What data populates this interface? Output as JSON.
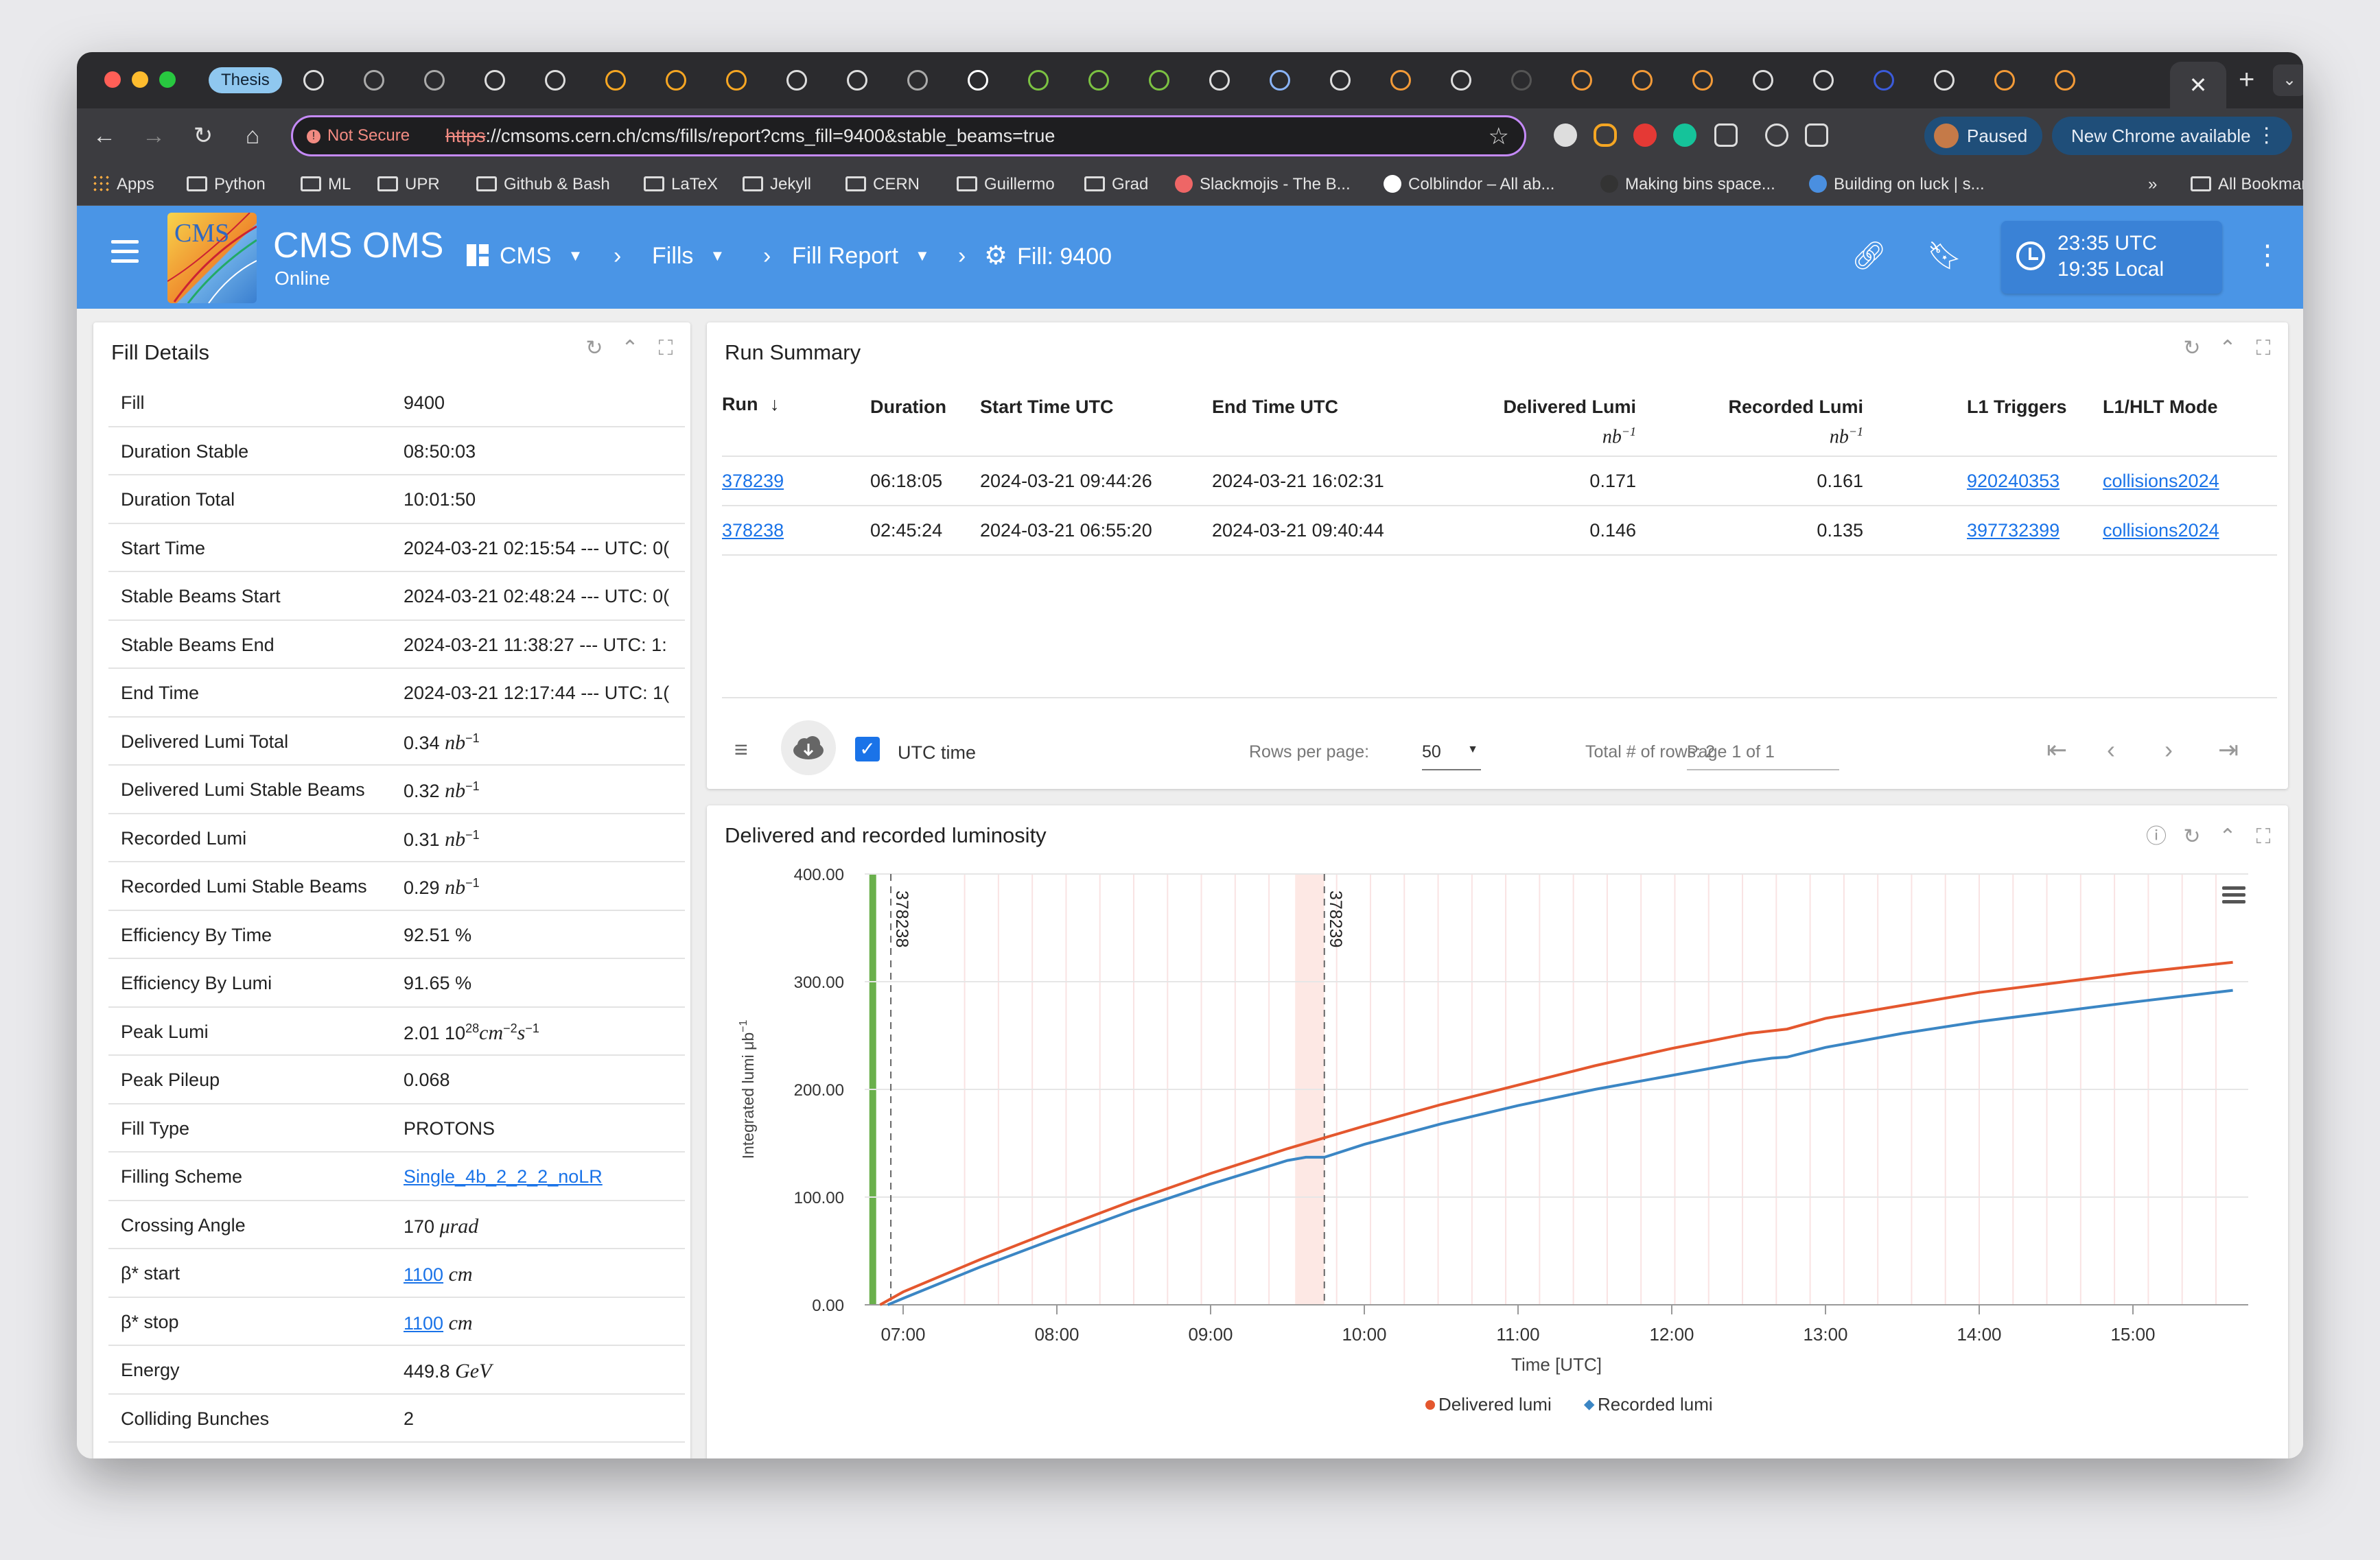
{
  "browser": {
    "tabs": {
      "pinned_label": "Thesis",
      "close_symbol": "✕",
      "new_tab_symbol": "+"
    },
    "url_bar": {
      "security_label": "Not Secure",
      "url_scheme": "https",
      "url_rest": "://cmsoms.cern.ch/cms/fills/report?cms_fill=9400&stable_beams=true"
    },
    "profile_label": "Paused",
    "update_label": "New Chrome available",
    "bookmarks": [
      "Apps",
      "Python",
      "ML",
      "UPR",
      "Github & Bash",
      "LaTeX",
      "Jekyll",
      "CERN",
      "Guillermo",
      "Grad",
      "Slackmojis - The B...",
      "Colblindor – All ab...",
      "Making bins space...",
      "Building on luck | s...",
      "»",
      "All Bookmarks"
    ]
  },
  "app": {
    "logo_text": "CMS",
    "title": "CMS OMS",
    "subtitle": "Online",
    "breadcrumbs": [
      "CMS",
      "Fills",
      "Fill Report",
      "Fill: 9400"
    ],
    "clock": {
      "utc": "23:35 UTC",
      "local": "19:35 Local"
    }
  },
  "fill_details": {
    "title": "Fill Details",
    "rows": [
      {
        "label": "Fill",
        "value": "9400"
      },
      {
        "label": "Duration Stable",
        "value": "08:50:03"
      },
      {
        "label": "Duration Total",
        "value": "10:01:50"
      },
      {
        "label": "Start Time",
        "value": "2024-03-21 02:15:54 --- UTC: 0("
      },
      {
        "label": "Stable Beams Start",
        "value": "2024-03-21 02:48:24 --- UTC: 0("
      },
      {
        "label": "Stable Beams End",
        "value": "2024-03-21 11:38:27 --- UTC: 1:"
      },
      {
        "label": "End Time",
        "value": "2024-03-21 12:17:44 --- UTC: 1("
      },
      {
        "label": "Delivered Lumi Total",
        "value": "0.34",
        "unit": "nb",
        "exp": "−1"
      },
      {
        "label": "Delivered Lumi Stable Beams",
        "value": "0.32",
        "unit": "nb",
        "exp": "−1"
      },
      {
        "label": "Recorded Lumi",
        "value": "0.31",
        "unit": "nb",
        "exp": "−1"
      },
      {
        "label": "Recorded Lumi Stable Beams",
        "value": "0.29",
        "unit": "nb",
        "exp": "−1"
      },
      {
        "label": "Efficiency By Time",
        "value": "92.51",
        "unit": "%"
      },
      {
        "label": "Efficiency By Lumi",
        "value": "91.65",
        "unit": "%"
      },
      {
        "label": "Peak Lumi",
        "value": "2.01 10",
        "exp": "28",
        "unit": "cm",
        "exp2": "−2",
        "unit2": "s",
        "exp3": "−1"
      },
      {
        "label": "Peak Pileup",
        "value": "0.068"
      },
      {
        "label": "Fill Type",
        "value": "PROTONS"
      },
      {
        "label": "Filling Scheme",
        "value": "Single_4b_2_2_2_noLR",
        "link": true
      },
      {
        "label": "Crossing Angle",
        "value": "170",
        "unit": "μrad"
      },
      {
        "label": "β* start",
        "value": "1100",
        "unit": "cm",
        "link": true
      },
      {
        "label": "β* stop",
        "value": "1100",
        "unit": "cm",
        "link": true
      },
      {
        "label": "Energy",
        "value": "449.8",
        "unit": "GeV"
      },
      {
        "label": "Colliding Bunches",
        "value": "2"
      }
    ]
  },
  "run_summary": {
    "title": "Run Summary",
    "columns": [
      "Run",
      "Duration",
      "Start Time UTC",
      "End Time UTC",
      "Delivered Lumi",
      "Recorded Lumi",
      "L1 Triggers",
      "L1/HLT Mode"
    ],
    "lumi_unit": "nb",
    "lumi_exp": "−1",
    "rows": [
      {
        "run": "378239",
        "duration": "06:18:05",
        "start": "2024-03-21 09:44:26",
        "end": "2024-03-21 16:02:31",
        "delivered": "0.171",
        "recorded": "0.161",
        "l1": "920240353",
        "mode": "collisions2024"
      },
      {
        "run": "378238",
        "duration": "02:45:24",
        "start": "2024-03-21 06:55:20",
        "end": "2024-03-21 09:40:44",
        "delivered": "0.146",
        "recorded": "0.135",
        "l1": "397732399",
        "mode": "collisions2024"
      }
    ],
    "footer": {
      "utc_label": "UTC time",
      "rows_per_page_label": "Rows per page:",
      "rows_per_page_value": "50",
      "total_rows": "Total # of rows: 2",
      "page": "Page 1 of 1"
    }
  },
  "lumi_chart": {
    "title": "Delivered and recorded luminosity"
  },
  "chart_data": {
    "type": "line",
    "title": "Delivered and recorded luminosity",
    "xlabel": "Time [UTC]",
    "ylabel": "Integrated lumi μb",
    "ylabel_exp": "−1",
    "x_ticks": [
      "07:00",
      "08:00",
      "09:00",
      "10:00",
      "11:00",
      "12:00",
      "13:00",
      "14:00",
      "15:00"
    ],
    "y_ticks": [
      "0.00",
      "100.00",
      "200.00",
      "300.00",
      "400.00"
    ],
    "xlim_hours": [
      6.75,
      15.75
    ],
    "ylim": [
      0,
      400
    ],
    "run_markers": [
      {
        "label": "378238",
        "time_hours": 6.92
      },
      {
        "label": "378239",
        "time_hours": 9.74
      }
    ],
    "legend_position": "bottom-center",
    "series": [
      {
        "name": "Delivered lumi",
        "color": "#e4572e",
        "x": [
          6.85,
          7.0,
          7.5,
          8.0,
          8.5,
          9.0,
          9.5,
          9.74,
          10.0,
          10.5,
          11.0,
          11.5,
          12.0,
          12.5,
          12.75,
          13.0,
          13.5,
          14.0,
          14.5,
          15.0,
          15.65
        ],
        "y": [
          0,
          12,
          42,
          70,
          97,
          122,
          145,
          155,
          166,
          186,
          204,
          222,
          238,
          252,
          256,
          266,
          278,
          290,
          299,
          308,
          318
        ]
      },
      {
        "name": "Recorded lumi",
        "color": "#3b86c4",
        "x": [
          6.9,
          7.0,
          7.5,
          8.0,
          8.5,
          9.0,
          9.5,
          9.62,
          9.74,
          10.0,
          10.5,
          11.0,
          11.5,
          12.0,
          12.5,
          12.65,
          12.75,
          13.0,
          13.5,
          14.0,
          14.5,
          15.0,
          15.65
        ],
        "y": [
          0,
          6,
          35,
          62,
          88,
          112,
          134,
          137,
          137,
          149,
          168,
          185,
          200,
          213,
          226,
          229,
          230,
          239,
          252,
          263,
          272,
          281,
          292
        ]
      }
    ]
  }
}
